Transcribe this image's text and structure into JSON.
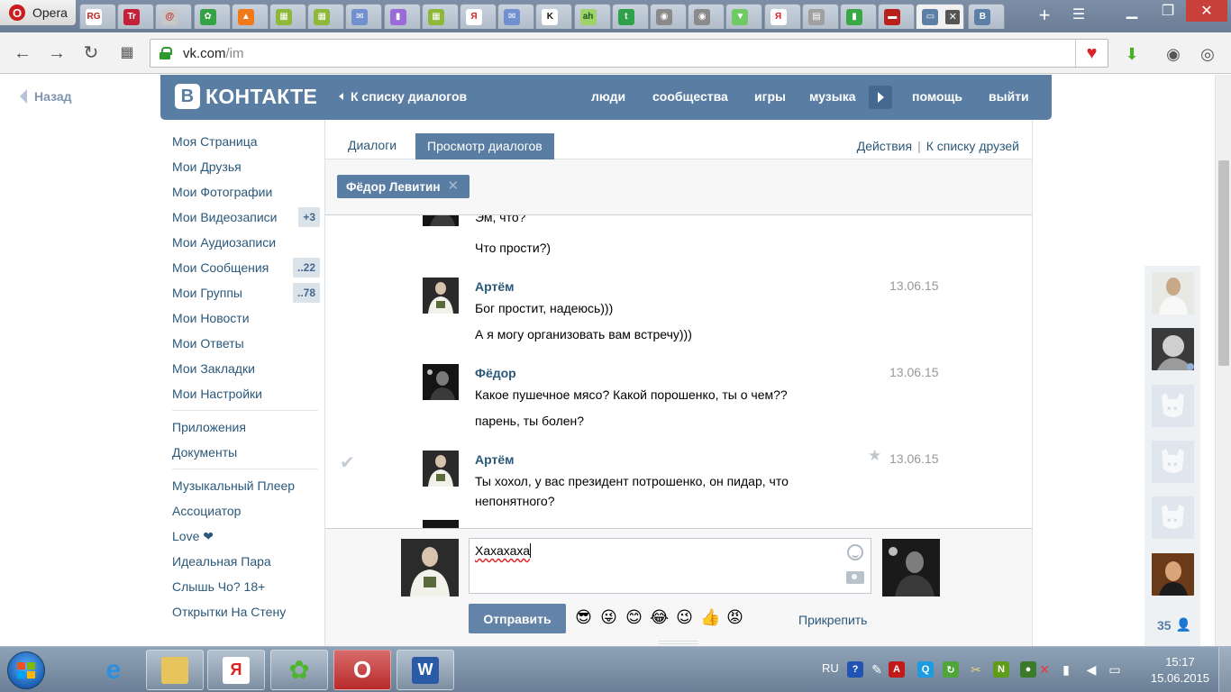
{
  "browser": {
    "menu_label": "Opera",
    "tabs": [
      {
        "label": "RG",
        "color": "#ffffff",
        "fg": "#c02020"
      },
      {
        "label": "Tr",
        "color": "#c3203a",
        "fg": "#ffffff"
      },
      {
        "label": "@",
        "color": "#c8c8c8",
        "fg": "#c03030"
      },
      {
        "label": "✿",
        "color": "#35a245",
        "fg": "#ffffff"
      },
      {
        "label": "▲",
        "color": "#f07a1a",
        "fg": "#ffffff"
      },
      {
        "label": "▦",
        "color": "#8db83a",
        "fg": "#ffffff"
      },
      {
        "label": "▦",
        "color": "#8db83a",
        "fg": "#ffffff"
      },
      {
        "label": "✉",
        "color": "#7090d0",
        "fg": "#ffffff"
      },
      {
        "label": "▮",
        "color": "#9a6ad8",
        "fg": "#ffffff"
      },
      {
        "label": "▦",
        "color": "#8db83a",
        "fg": "#ffffff"
      },
      {
        "label": "Я",
        "color": "#ffffff",
        "fg": "#e02020"
      },
      {
        "label": "✉",
        "color": "#7090d0",
        "fg": "#ffffff"
      },
      {
        "label": "K",
        "color": "#ffffff",
        "fg": "#111111"
      },
      {
        "label": "ah",
        "color": "#9fd36a",
        "fg": "#1a5a1a"
      },
      {
        "label": "t",
        "color": "#2da24a",
        "fg": "#ffffff"
      },
      {
        "label": "◉",
        "color": "#8a8a8a",
        "fg": "#ffffff"
      },
      {
        "label": "◉",
        "color": "#8a8a8a",
        "fg": "#ffffff"
      },
      {
        "label": "▼",
        "color": "#6ecb63",
        "fg": "#ffffff"
      },
      {
        "label": "Я",
        "color": "#ffffff",
        "fg": "#e02020"
      },
      {
        "label": "▤",
        "color": "#a0a0a0",
        "fg": "#ffffff"
      },
      {
        "label": "▮",
        "color": "#3aa844",
        "fg": "#ffffff"
      },
      {
        "label": "▬",
        "color": "#b8201a",
        "fg": "#ffffff"
      },
      {
        "label": "▭",
        "color": "#5b7fa6",
        "fg": "#ffffff"
      },
      {
        "label": "B",
        "color": "#5b7fa6",
        "fg": "#ffffff"
      }
    ],
    "url_host": "vk.com",
    "url_path": "/im"
  },
  "page": {
    "back_label": "Назад"
  },
  "vk": {
    "logo_letter": "В",
    "logo_text": "КОНТАКТЕ",
    "back_to_dialogs": "К списку диалогов",
    "nav": {
      "people": "люди",
      "communities": "сообщества",
      "games": "игры",
      "music": "музыка",
      "help": "помощь",
      "logout": "выйти"
    }
  },
  "sidebar": {
    "items": [
      {
        "label": "Моя Страница",
        "badge": ""
      },
      {
        "label": "Мои Друзья",
        "badge": ""
      },
      {
        "label": "Мои Фотографии",
        "badge": ""
      },
      {
        "label": "Мои Видеозаписи",
        "badge": "+3"
      },
      {
        "label": "Мои Аудиозаписи",
        "badge": ""
      },
      {
        "label": "Мои Сообщения",
        "badge": "..22"
      },
      {
        "label": "Мои Группы",
        "badge": "..78"
      },
      {
        "label": "Мои Новости",
        "badge": ""
      },
      {
        "label": "Мои Ответы",
        "badge": ""
      },
      {
        "label": "Мои Закладки",
        "badge": ""
      },
      {
        "label": "Мои Настройки",
        "badge": ""
      }
    ],
    "apps": [
      "Приложения",
      "Документы"
    ],
    "extras": [
      "Музыкальный Плеер",
      "Ассоциатор",
      "Love ❤",
      "Идеальная Пара",
      "Слышь Чо? 18+",
      "Открытки На Стену"
    ]
  },
  "im": {
    "tab_dialogs": "Диалоги",
    "tab_view": "Просмотр диалогов",
    "actions": "Действия",
    "actions_sep": "|",
    "friends_link": "К списку друзей",
    "chip_name": "Фёдор Левитин",
    "messages": [
      {
        "name": "",
        "date": "",
        "lines": [
          "Эм, что?"
        ],
        "ava": "dark"
      },
      {
        "name": "",
        "date": "",
        "lines": [
          "Что прости?)"
        ],
        "ava": ""
      },
      {
        "name": "Артём",
        "date": "13.06.15",
        "lines": [
          "Бог простит, надеюсь)))"
        ],
        "ava": "light"
      },
      {
        "name": "",
        "date": "",
        "lines": [
          "А я могу организовать вам встречу)))"
        ],
        "ava": ""
      },
      {
        "name": "Фёдор",
        "date": "13.06.15",
        "lines": [
          "Какое пушечное мясо? Какой порошенко, ты о чем??"
        ],
        "ava": "dark"
      },
      {
        "name": "",
        "date": "",
        "lines": [
          "парень, ты болен?"
        ],
        "ava": ""
      },
      {
        "name": "Артём",
        "date": "13.06.15",
        "lines": [
          "Ты хохол, у вас президент потрошенко, он пидар, что непонятного?"
        ],
        "ava": "light"
      }
    ],
    "compose_text": "Хахахаха",
    "send_label": "Отправить",
    "attach_label": "Прикрепить",
    "emoji": [
      "😎",
      "😜",
      "😊",
      "😂",
      "😉",
      "👍",
      "😡"
    ]
  },
  "rail": {
    "count": "35"
  },
  "taskbar": {
    "lang": "RU",
    "time": "15:17",
    "date": "15.06.2015"
  }
}
